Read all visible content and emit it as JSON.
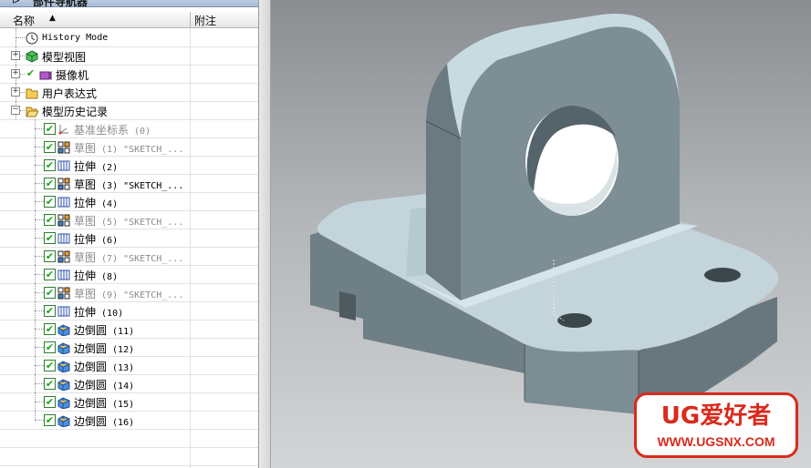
{
  "navigator": {
    "title": "部件导航器",
    "columns": {
      "name": "名称",
      "note": "附注"
    },
    "rows": [
      {
        "label": "History Mode",
        "level": 1,
        "icon": "clock-icon",
        "expander": "",
        "checked": false,
        "grey": false
      },
      {
        "label": "模型视图",
        "level": 1,
        "icon": "model-views-icon",
        "expander": "+",
        "checked": false,
        "grey": false
      },
      {
        "label": "摄像机",
        "level": 1,
        "icon": "camera-icon",
        "expander": "+",
        "checked": true,
        "grey": false
      },
      {
        "label": "用户表达式",
        "level": 1,
        "icon": "folder-icon",
        "expander": "+",
        "checked": false,
        "grey": false
      },
      {
        "label": "模型历史记录",
        "level": 1,
        "icon": "folder-open-icon",
        "expander": "-",
        "checked": false,
        "grey": false
      },
      {
        "label": "基准坐标系",
        "suffix": " (0)",
        "level": 2,
        "icon": "datum-csys-icon",
        "checked": true,
        "grey": true
      },
      {
        "label": "草图",
        "suffix": " (1) \"SKETCH_...",
        "level": 2,
        "icon": "sketch-icon",
        "checked": true,
        "grey": true
      },
      {
        "label": "拉伸",
        "suffix": " (2)",
        "level": 2,
        "icon": "extrude-icon",
        "checked": true,
        "grey": false
      },
      {
        "label": "草图",
        "suffix": " (3) \"SKETCH_...",
        "level": 2,
        "icon": "sketch-icon",
        "checked": true,
        "grey": false
      },
      {
        "label": "拉伸",
        "suffix": " (4)",
        "level": 2,
        "icon": "extrude-icon",
        "checked": true,
        "grey": false
      },
      {
        "label": "草图",
        "suffix": " (5) \"SKETCH_...",
        "level": 2,
        "icon": "sketch-icon",
        "checked": true,
        "grey": true
      },
      {
        "label": "拉伸",
        "suffix": " (6)",
        "level": 2,
        "icon": "extrude-icon",
        "checked": true,
        "grey": false
      },
      {
        "label": "草图",
        "suffix": " (7) \"SKETCH_...",
        "level": 2,
        "icon": "sketch-icon",
        "checked": true,
        "grey": true
      },
      {
        "label": "拉伸",
        "suffix": " (8)",
        "level": 2,
        "icon": "extrude-icon",
        "checked": true,
        "grey": false
      },
      {
        "label": "草图",
        "suffix": " (9) \"SKETCH_...",
        "level": 2,
        "icon": "sketch-icon",
        "checked": true,
        "grey": true
      },
      {
        "label": "拉伸",
        "suffix": " (10)",
        "level": 2,
        "icon": "extrude-icon",
        "checked": true,
        "grey": false
      },
      {
        "label": "边倒圆",
        "suffix": " (11)",
        "level": 2,
        "icon": "edge-blend-icon",
        "checked": true,
        "grey": false
      },
      {
        "label": "边倒圆",
        "suffix": " (12)",
        "level": 2,
        "icon": "edge-blend-icon",
        "checked": true,
        "grey": false
      },
      {
        "label": "边倒圆",
        "suffix": " (13)",
        "level": 2,
        "icon": "edge-blend-icon",
        "checked": true,
        "grey": false
      },
      {
        "label": "边倒圆",
        "suffix": " (14)",
        "level": 2,
        "icon": "edge-blend-icon",
        "checked": true,
        "grey": false
      },
      {
        "label": "边倒圆",
        "suffix": " (15)",
        "level": 2,
        "icon": "edge-blend-icon",
        "checked": true,
        "grey": false
      },
      {
        "label": "边倒圆",
        "suffix": " (16)",
        "level": 2,
        "icon": "edge-blend-icon",
        "checked": true,
        "grey": false
      }
    ],
    "empty_rows": 3
  },
  "watermark": {
    "brand": "UG爱好者",
    "url": "WWW.UGSNX.COM"
  },
  "colors": {
    "part": "#7d8e95",
    "part_top": "#c6d8de",
    "watermark_red": "#d92a1c"
  }
}
